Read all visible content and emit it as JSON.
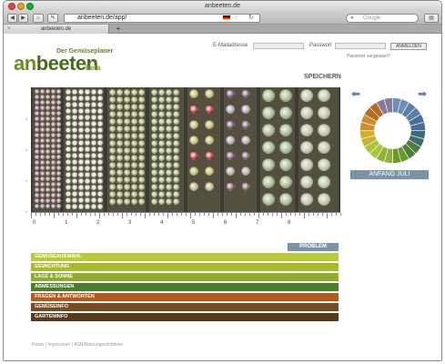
{
  "window": {
    "title": "anbeeten.de"
  },
  "browser": {
    "address": "anbeeten.de/app/",
    "search_placeholder": "Google",
    "tab_title": "anbeeten.de",
    "new_tab": "+"
  },
  "header": {
    "subtitle": "Der Gemüseplaner",
    "logo_part1": "an",
    "logo_part2": "beeten",
    "beta": "beta",
    "email_label": "E-Mailadresse",
    "password_label": "Passwort",
    "login_button": "ANMELDEN",
    "forgot": "Passwort vergessen?"
  },
  "save_label": "SPEICHERN",
  "ruler": {
    "labels": [
      "0",
      "1",
      "2",
      "3",
      "4",
      "5",
      "6",
      "7",
      "8"
    ]
  },
  "y_labels": [
    "3",
    "2",
    "1",
    "0"
  ],
  "calendar": {
    "month_label": "ANFANG JULI"
  },
  "problem_button": "PROBLEM MELDEN",
  "sections": [
    {
      "label": "GEMÜSEAUSWAHL",
      "color": "#b9c93a"
    },
    {
      "label": "GEWICHTUNG",
      "color": "#a7bb2d"
    },
    {
      "label": "LAGE & SONNE",
      "color": "#8fac2f"
    },
    {
      "label": "ABMESSUNGEN",
      "color": "#4b7d2c"
    },
    {
      "label": "FRAGEN & ANTWORTEN",
      "color": "#b45a1e"
    },
    {
      "label": "GEMÜSEINFO",
      "color": "#7a4a21"
    },
    {
      "label": "GARTENINFO",
      "color": "#5a3a1e"
    }
  ],
  "footer": "Home | Impressum | AGB/Nutzungsrichtlinien"
}
